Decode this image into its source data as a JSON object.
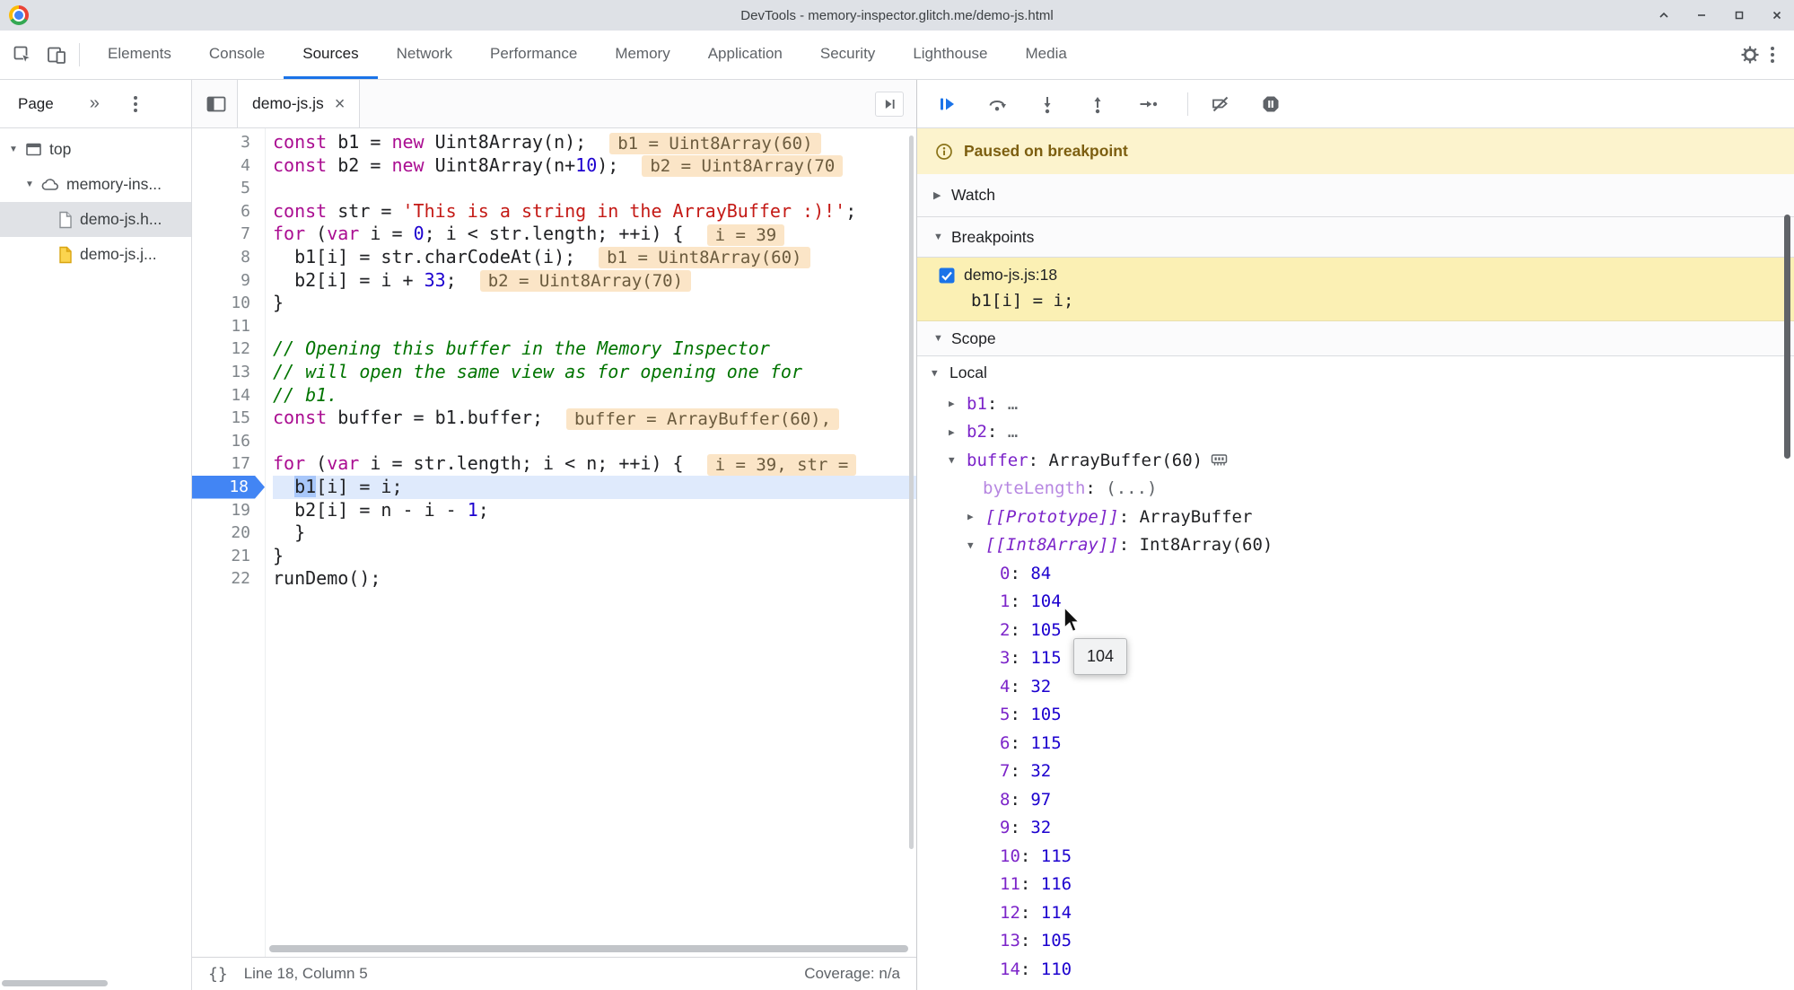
{
  "window": {
    "title": "DevTools - memory-inspector.glitch.me/demo-js.html"
  },
  "icons": {
    "expanded": "▼",
    "collapsed": "▶",
    "chevrons": "»",
    "close": "×"
  },
  "colors": {
    "accent": "#1a73e8",
    "paused_banner_bg": "#fcf3cd",
    "breakpoint_bg": "#fbf0b4",
    "current_line_bg": "#dfeafc",
    "inline_eval_bg": "#fbe5c7"
  },
  "tabbar": {
    "tabs": [
      "Elements",
      "Console",
      "Sources",
      "Network",
      "Performance",
      "Memory",
      "Application",
      "Security",
      "Lighthouse",
      "Media"
    ],
    "active": "Sources"
  },
  "navigator": {
    "tab_label": "Page",
    "tree": [
      {
        "label": "top"
      },
      {
        "label": "memory-ins..."
      },
      {
        "label": "demo-js.h..."
      },
      {
        "label": "demo-js.j..."
      }
    ]
  },
  "editor": {
    "tab_label": "demo-js.js",
    "status": {
      "pretty_print": "{}",
      "line_col": "Line 18, Column 5",
      "coverage": "Coverage: n/a"
    },
    "lines": [
      {
        "n": 3,
        "seg": [
          [
            "const",
            "k"
          ],
          [
            " b1 = ",
            "p"
          ],
          [
            "new",
            "k"
          ],
          [
            " Uint8Array(n);",
            "p"
          ]
        ],
        "badge": "b1 = Uint8Array(60)"
      },
      {
        "n": 4,
        "seg": [
          [
            "const",
            "k"
          ],
          [
            " b2 = ",
            "p"
          ],
          [
            "new",
            "k"
          ],
          [
            " Uint8Array(n+",
            "p"
          ],
          [
            "10",
            "n"
          ],
          [
            ");",
            "p"
          ]
        ],
        "badge": "b2 = Uint8Array(70"
      },
      {
        "n": 5,
        "seg": []
      },
      {
        "n": 6,
        "seg": [
          [
            "const",
            "k"
          ],
          [
            " str = ",
            "p"
          ],
          [
            "'This is a string in the ArrayBuffer :)!'",
            "s"
          ],
          [
            ";",
            "p"
          ]
        ]
      },
      {
        "n": 7,
        "seg": [
          [
            "for",
            "k"
          ],
          [
            " (",
            "p"
          ],
          [
            "var",
            "k"
          ],
          [
            " i = ",
            "p"
          ],
          [
            "0",
            "n"
          ],
          [
            "; i < str.length; ++i) {",
            "p"
          ]
        ],
        "badge": "i = 39"
      },
      {
        "n": 8,
        "seg": [
          [
            "  b1[i] = str.charCodeAt(i);",
            "p"
          ]
        ],
        "badge": "b1 = Uint8Array(60)"
      },
      {
        "n": 9,
        "seg": [
          [
            "  b2[i] = i + ",
            "p"
          ],
          [
            "33",
            "n"
          ],
          [
            ";",
            "p"
          ]
        ],
        "badge": "b2 = Uint8Array(70)"
      },
      {
        "n": 10,
        "seg": [
          [
            "}",
            "p"
          ]
        ]
      },
      {
        "n": 11,
        "seg": []
      },
      {
        "n": 12,
        "seg": [
          [
            "// Opening this buffer in the Memory Inspector",
            "c"
          ]
        ]
      },
      {
        "n": 13,
        "seg": [
          [
            "// will open the same view as for opening one for",
            "c"
          ]
        ]
      },
      {
        "n": 14,
        "seg": [
          [
            "// b1.",
            "c"
          ]
        ]
      },
      {
        "n": 15,
        "seg": [
          [
            "const",
            "k"
          ],
          [
            " buffer = b1.buffer;",
            "p"
          ]
        ],
        "badge": "buffer = ArrayBuffer(60),"
      },
      {
        "n": 16,
        "seg": []
      },
      {
        "n": 17,
        "seg": [
          [
            "for",
            "k"
          ],
          [
            " (",
            "p"
          ],
          [
            "var",
            "k"
          ],
          [
            " i = str.length; i < n; ++i) {",
            "p"
          ]
        ],
        "badge": "i = 39, str ="
      },
      {
        "n": 18,
        "current": true,
        "seg": [
          [
            "  ",
            "p"
          ],
          [
            "b1",
            "sel"
          ],
          [
            "[i] = i;",
            "p"
          ]
        ]
      },
      {
        "n": 19,
        "seg": [
          [
            "  b2[i] = n - i - ",
            "p"
          ],
          [
            "1",
            "n"
          ],
          [
            ";",
            "p"
          ]
        ]
      },
      {
        "n": 20,
        "seg": [
          [
            "  }",
            "p"
          ]
        ]
      },
      {
        "n": 21,
        "seg": [
          [
            "}",
            "p"
          ]
        ]
      },
      {
        "n": 22,
        "seg": [
          [
            "runDemo();",
            "p"
          ]
        ]
      }
    ]
  },
  "debugger": {
    "paused_message": "Paused on breakpoint",
    "watch_label": "Watch",
    "breakpoints_label": "Breakpoints",
    "scope_label": "Scope",
    "breakpoint": {
      "location": "demo-js.js:18",
      "code": "b1[i] = i;",
      "checked": true
    },
    "tooltip_value": "104",
    "scope_rows": [
      {
        "cls": "lvl-sec",
        "section": true,
        "arrow": "▼",
        "name": "Local"
      },
      {
        "cls": "lvl-var",
        "arrow": "▶",
        "name": "b1",
        "value": "…",
        "vcls": "dim"
      },
      {
        "cls": "lvl-var",
        "arrow": "▶",
        "name": "b2",
        "value": "…",
        "vcls": "dim"
      },
      {
        "cls": "lvl-var",
        "arrow": "▼",
        "name": "buffer",
        "value": "ArrayBuffer(60)",
        "vcls": "obj",
        "icon": "memory-inspector"
      },
      {
        "cls": "lvl-prop",
        "name": "byteLength",
        "nstyle": "faded",
        "value": "(...)",
        "vcls": "dim"
      },
      {
        "cls": "lvl-int",
        "arrow": "▶",
        "name": "[[Prototype]]",
        "nstyle": "internal",
        "value": "ArrayBuffer",
        "vcls": "obj"
      },
      {
        "cls": "lvl-int",
        "arrow": "▼",
        "name": "[[Int8Array]]",
        "nstyle": "internal",
        "value": "Int8Array(60)",
        "vcls": "obj"
      },
      {
        "cls": "lvl-idx",
        "name": "0",
        "value": "84",
        "vcls": "num"
      },
      {
        "cls": "lvl-idx",
        "name": "1",
        "value": "104",
        "vcls": "num"
      },
      {
        "cls": "lvl-idx",
        "name": "2",
        "value": "105",
        "vcls": "num"
      },
      {
        "cls": "lvl-idx",
        "name": "3",
        "value": "115",
        "vcls": "num"
      },
      {
        "cls": "lvl-idx",
        "name": "4",
        "value": "32",
        "vcls": "num"
      },
      {
        "cls": "lvl-idx",
        "name": "5",
        "value": "105",
        "vcls": "num"
      },
      {
        "cls": "lvl-idx",
        "name": "6",
        "value": "115",
        "vcls": "num"
      },
      {
        "cls": "lvl-idx",
        "name": "7",
        "value": "32",
        "vcls": "num"
      },
      {
        "cls": "lvl-idx",
        "name": "8",
        "value": "97",
        "vcls": "num"
      },
      {
        "cls": "lvl-idx",
        "name": "9",
        "value": "32",
        "vcls": "num"
      },
      {
        "cls": "lvl-idx",
        "name": "10",
        "value": "115",
        "vcls": "num"
      },
      {
        "cls": "lvl-idx",
        "name": "11",
        "value": "116",
        "vcls": "num"
      },
      {
        "cls": "lvl-idx",
        "name": "12",
        "value": "114",
        "vcls": "num"
      },
      {
        "cls": "lvl-idx",
        "name": "13",
        "value": "105",
        "vcls": "num"
      },
      {
        "cls": "lvl-idx",
        "name": "14",
        "value": "110",
        "vcls": "num"
      }
    ]
  }
}
